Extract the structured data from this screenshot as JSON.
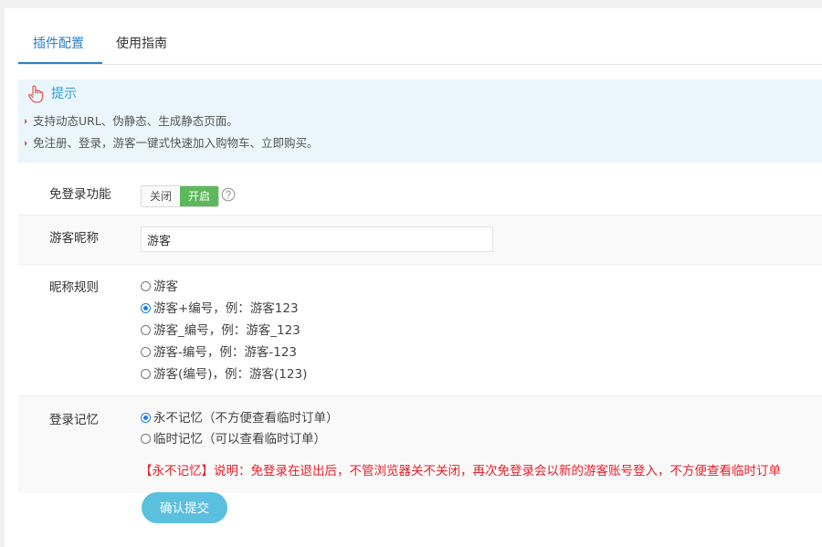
{
  "tabs": [
    {
      "label": "插件配置",
      "active": true
    },
    {
      "label": "使用指南",
      "active": false
    }
  ],
  "tip": {
    "icon": "hand-pointer-icon",
    "title": "提示",
    "lines": [
      "支持动态URL、伪静态、生成静态页面。",
      "免注册、登录，游客一键式快速加入购物车、立即购买。"
    ]
  },
  "form": {
    "login_free": {
      "label": "免登录功能",
      "off_label": "关闭",
      "on_label": "开启",
      "value": "on",
      "help_icon": "question-circle-icon"
    },
    "nickname": {
      "label": "游客昵称",
      "value": "游客"
    },
    "nickname_rule": {
      "label": "昵称规则",
      "options": [
        {
          "label": "游客",
          "checked": false
        },
        {
          "label": "游客+编号，例：游客123",
          "checked": true
        },
        {
          "label": "游客_编号，例：游客_123",
          "checked": false
        },
        {
          "label": "游客-编号，例：游客-123",
          "checked": false
        },
        {
          "label": "游客(编号)，例：游客(123)",
          "checked": false
        }
      ]
    },
    "login_memory": {
      "label": "登录记忆",
      "options": [
        {
          "label": "永不记忆（不方便查看临时订单）",
          "checked": true
        },
        {
          "label": "临时记忆（可以查看临时订单）",
          "checked": false
        }
      ],
      "note": "【永不记忆】说明：免登录在退出后，不管浏览器关不关闭，再次免登录会以新的游客账号登入，不方便查看临时订单"
    },
    "submit_label": "确认提交"
  },
  "colors": {
    "accent": "#2b83c4",
    "toggle_on": "#5cb85c",
    "tip_bg": "#eaf6fb",
    "warning": "#e8202a",
    "submit": "#5bc0de"
  }
}
